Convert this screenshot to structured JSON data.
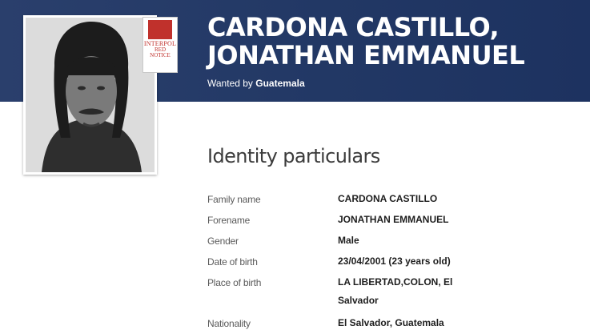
{
  "header": {
    "badge_org": "INTERPOL",
    "badge_line1": "RED",
    "badge_line2": "NOTICE",
    "name": "CARDONA CASTILLO, JONATHAN EMMANUEL",
    "wanted_prefix": "Wanted by",
    "wanted_country": "Guatemala",
    "colors": {
      "header_bg": "#223865",
      "badge_red": "#c0312c"
    }
  },
  "identity": {
    "title": "Identity particulars",
    "rows": [
      {
        "label": "Family name",
        "value": "CARDONA CASTILLO"
      },
      {
        "label": "Forename",
        "value": "JONATHAN EMMANUEL"
      },
      {
        "label": "Gender",
        "value": "Male"
      },
      {
        "label": "Date of birth",
        "value": "23/04/2001 (23 years old)"
      },
      {
        "label": "Place of birth",
        "value": "LA LIBERTAD,COLON, El Salvador"
      },
      {
        "label": "Nationality",
        "value": "El Salvador, Guatemala"
      }
    ]
  }
}
